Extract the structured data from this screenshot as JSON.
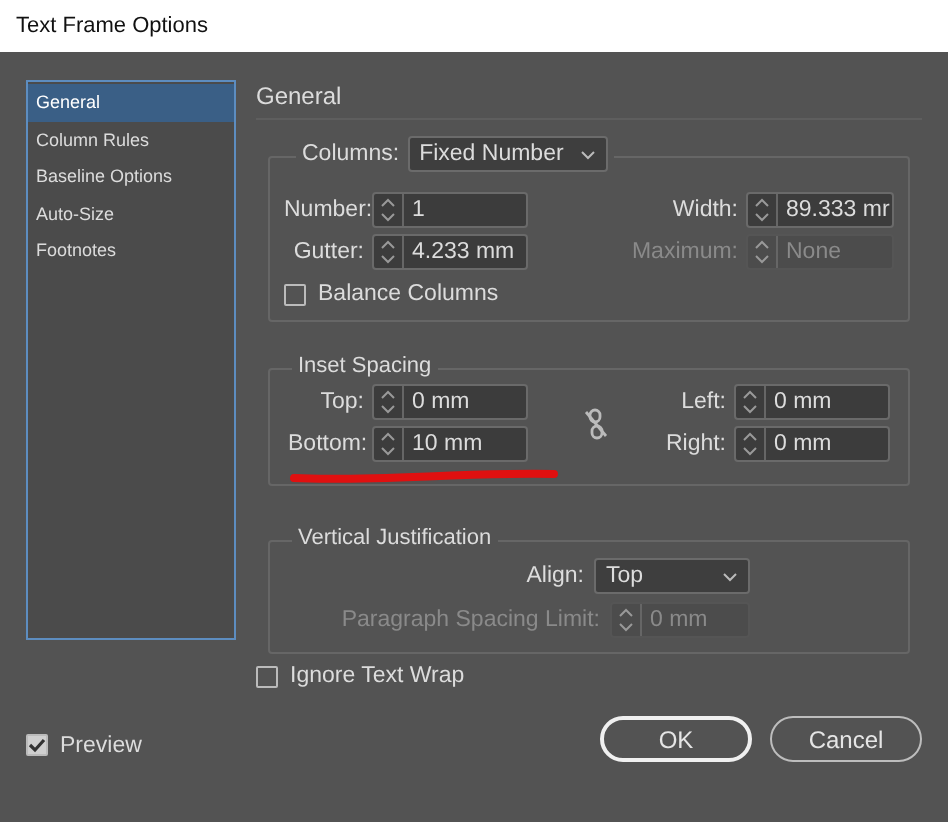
{
  "window": {
    "title": "Text Frame Options"
  },
  "sidebar": {
    "items": [
      {
        "label": "General",
        "selected": true
      },
      {
        "label": "Column Rules",
        "selected": false
      },
      {
        "label": "Baseline Options",
        "selected": false
      },
      {
        "label": "Auto-Size",
        "selected": false
      },
      {
        "label": "Footnotes",
        "selected": false
      }
    ]
  },
  "heading": "General",
  "columns_group": {
    "label": "Columns:",
    "value": "Fixed Number",
    "left_fields": [
      {
        "label": "Number:",
        "value": "1",
        "disabled": false
      },
      {
        "label": "Gutter:",
        "value": "4.233 mm",
        "disabled": false
      }
    ],
    "right_fields": [
      {
        "label": "Width:",
        "value": "89.333 mr",
        "disabled": false
      },
      {
        "label": "Maximum:",
        "value": "None",
        "disabled": true
      }
    ],
    "balance": {
      "label": "Balance Columns",
      "checked": false
    }
  },
  "inset_spacing": {
    "title": "Inset Spacing",
    "left_fields": [
      {
        "label": "Top:",
        "value": "0 mm",
        "disabled": false
      },
      {
        "label": "Bottom:",
        "value": "10 mm",
        "disabled": false
      }
    ],
    "right_fields": [
      {
        "label": "Left:",
        "value": "0 mm",
        "disabled": false
      },
      {
        "label": "Right:",
        "value": "0 mm",
        "disabled": false
      }
    ]
  },
  "vertical_justification": {
    "title": "Vertical Justification",
    "align": {
      "label": "Align:",
      "value": "Top"
    },
    "spacing_limit": {
      "label": "Paragraph Spacing Limit:",
      "value": "0 mm",
      "disabled": true
    }
  },
  "ignore_text_wrap": {
    "label": "Ignore Text Wrap",
    "checked": false
  },
  "preview": {
    "label": "Preview",
    "checked": true
  },
  "buttons": [
    {
      "label": "OK",
      "kind": "default"
    },
    {
      "label": "Cancel",
      "kind": "normal"
    }
  ]
}
